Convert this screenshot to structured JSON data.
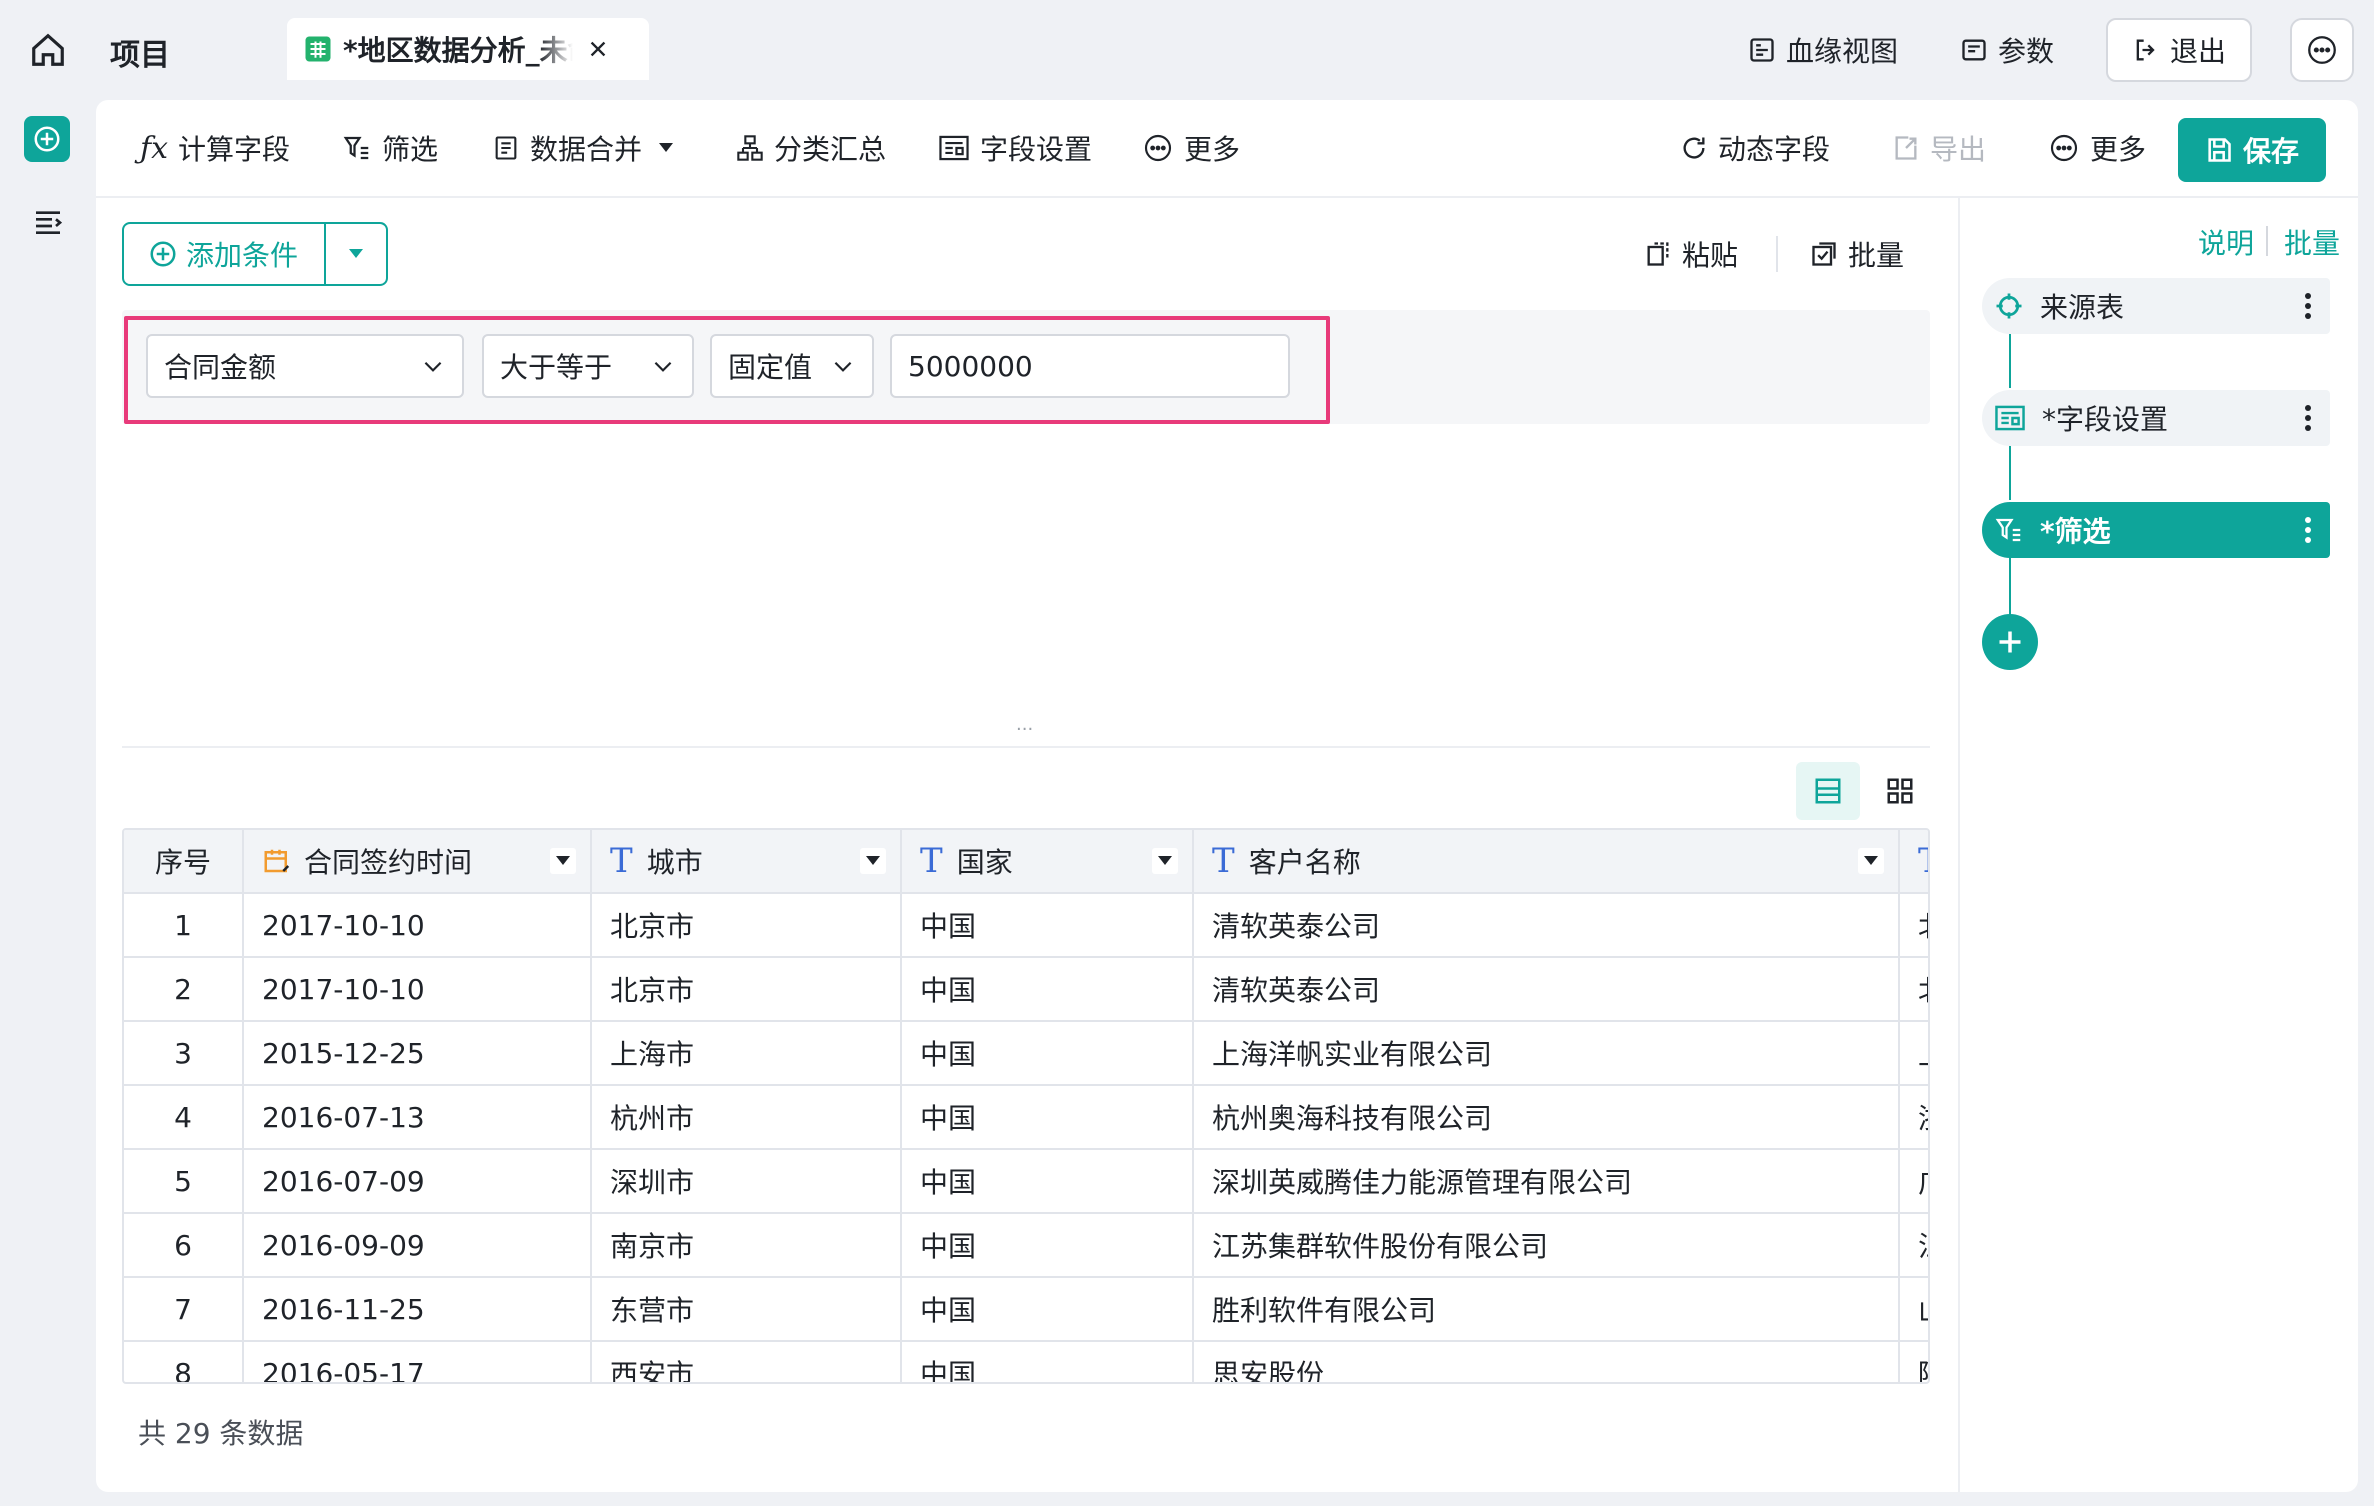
{
  "topbar": {
    "project_label": "项目",
    "tab_title": "*地区数据分析_未命名",
    "lineage_label": "血缘视图",
    "params_label": "参数",
    "exit_label": "退出"
  },
  "toolbar": {
    "calc_field": "计算字段",
    "filter": "筛选",
    "merge": "数据合并",
    "group_summary": "分类汇总",
    "field_settings": "字段设置",
    "more_left": "更多",
    "dynamic_field": "动态字段",
    "export": "导出",
    "more_right": "更多",
    "save": "保存"
  },
  "filter": {
    "add_condition": "添加条件",
    "paste": "粘贴",
    "batch": "批量",
    "field": "合同金额",
    "operator": "大于等于",
    "value_type": "固定值",
    "value": "5000000",
    "splitter": "..."
  },
  "table": {
    "columns": [
      "序号",
      "合同签约时间",
      "城市",
      "国家",
      "客户名称"
    ],
    "rows": [
      {
        "n": "1",
        "date": "2017-10-10",
        "city": "北京市",
        "country": "中国",
        "customer": "清软英泰公司",
        "extra": "北"
      },
      {
        "n": "2",
        "date": "2017-10-10",
        "city": "北京市",
        "country": "中国",
        "customer": "清软英泰公司",
        "extra": "北"
      },
      {
        "n": "3",
        "date": "2015-12-25",
        "city": "上海市",
        "country": "中国",
        "customer": "上海洋帆实业有限公司",
        "extra": "上"
      },
      {
        "n": "4",
        "date": "2016-07-13",
        "city": "杭州市",
        "country": "中国",
        "customer": "杭州奥海科技有限公司",
        "extra": "浙"
      },
      {
        "n": "5",
        "date": "2016-07-09",
        "city": "深圳市",
        "country": "中国",
        "customer": "深圳英威腾佳力能源管理有限公司",
        "extra": "广"
      },
      {
        "n": "6",
        "date": "2016-09-09",
        "city": "南京市",
        "country": "中国",
        "customer": "江苏集群软件股份有限公司",
        "extra": "江"
      },
      {
        "n": "7",
        "date": "2016-11-25",
        "city": "东营市",
        "country": "中国",
        "customer": "胜利软件有限公司",
        "extra": "山"
      },
      {
        "n": "8",
        "date": "2016-05-17",
        "city": "西安市",
        "country": "中国",
        "customer": "思安股份",
        "extra": "陕"
      }
    ],
    "footer": "共 29 条数据"
  },
  "flow": {
    "help": "说明",
    "batch": "批量",
    "steps": [
      "来源表",
      "*字段设置",
      "*筛选"
    ]
  },
  "colors": {
    "accent": "#0ea59a",
    "highlight_border": "#e83a7a"
  }
}
